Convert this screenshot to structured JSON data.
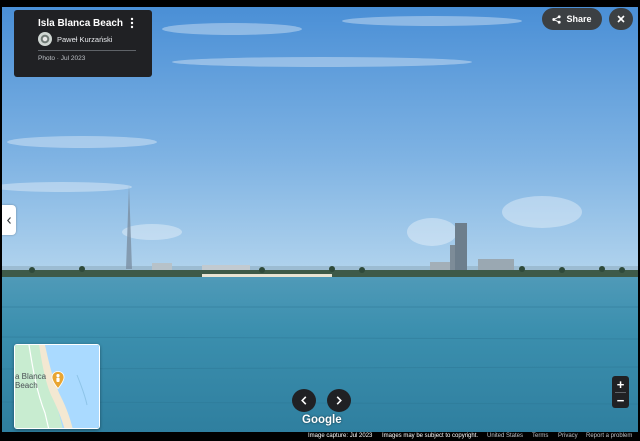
{
  "info_card": {
    "title": "Isla Blanca Beach",
    "author": "Paweł Kurzański",
    "date": "Photo · Jul 2023",
    "more_icon": "more-vert-icon"
  },
  "top_actions": {
    "share_label": "Share",
    "share_icon": "share-icon",
    "close_icon": "close-icon"
  },
  "side_tab": {
    "icon": "chevron-left-icon"
  },
  "minimap": {
    "label": "a Blanca\nBeach",
    "marker_icon": "pegman-icon",
    "water_color": "#aadaff",
    "land_color": "#c8ecd0"
  },
  "navigation": {
    "prev_icon": "chevron-left-icon",
    "next_icon": "chevron-right-icon",
    "logo": "Google"
  },
  "zoom": {
    "in_label": "+",
    "out_label": "−"
  },
  "footer": {
    "capture": "Image capture: Jul 2023",
    "copyright": "Images may be subject to copyright.",
    "united_states": "United States",
    "terms": "Terms",
    "privacy": "Privacy",
    "report": "Report a problem"
  },
  "colors": {
    "sky_top": "#4a8fd6",
    "sky_horizon": "#a7cdec",
    "water": "#3b8fae",
    "panel": "#202124"
  }
}
